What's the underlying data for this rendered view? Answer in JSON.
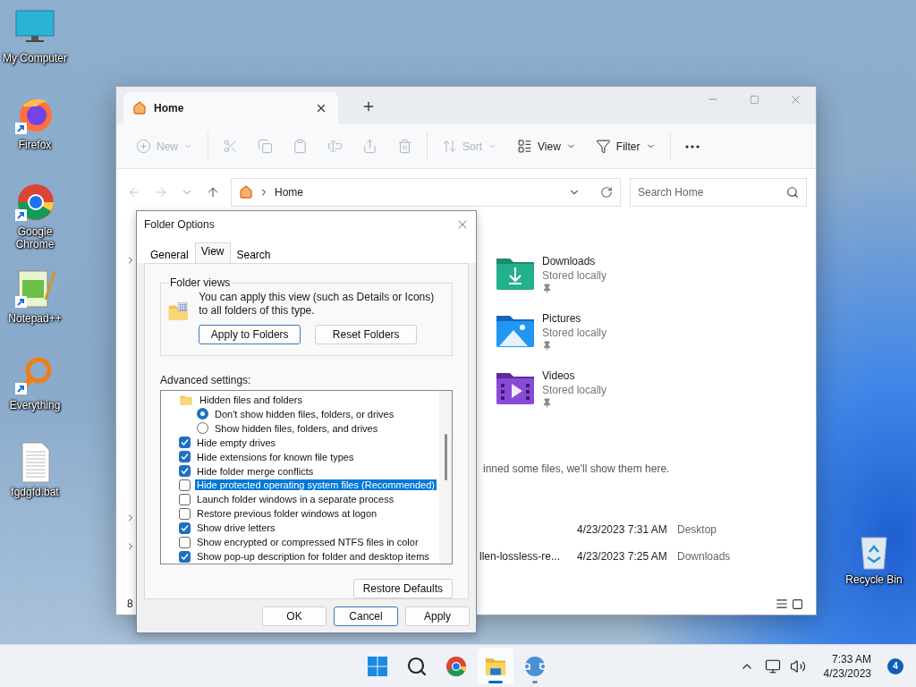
{
  "desktop_icons": [
    {
      "kind": "computer",
      "label": "My Computer",
      "shortcut": false
    },
    {
      "kind": "firefox",
      "label": "Firefox",
      "shortcut": true
    },
    {
      "kind": "chrome",
      "label": "Google Chrome",
      "shortcut": true
    },
    {
      "kind": "notepad",
      "label": "Notepad++",
      "shortcut": true
    },
    {
      "kind": "everything",
      "label": "Everything",
      "shortcut": true
    },
    {
      "kind": "textfile",
      "label": "fgdgfd.bat",
      "shortcut": false
    }
  ],
  "recycle_bin": {
    "label": "Recycle Bin"
  },
  "explorer": {
    "tab": {
      "title": "Home"
    },
    "toolbar": [
      {
        "kind": "new",
        "label": "New",
        "disabled": true,
        "dropdown": true
      },
      {
        "kind": "cut",
        "disabled": true
      },
      {
        "kind": "copy",
        "disabled": true
      },
      {
        "kind": "paste",
        "disabled": true
      },
      {
        "kind": "rename",
        "disabled": true
      },
      {
        "kind": "share",
        "disabled": true
      },
      {
        "kind": "delete",
        "disabled": true
      },
      {
        "kind": "sort",
        "label": "Sort",
        "disabled": true,
        "dropdown": true
      },
      {
        "kind": "view",
        "label": "View",
        "disabled": false,
        "dropdown": true
      },
      {
        "kind": "filter",
        "label": "Filter",
        "disabled": false,
        "dropdown": true
      },
      {
        "kind": "more",
        "disabled": false
      }
    ],
    "address": {
      "crumb": "Home"
    },
    "search": {
      "placeholder": "Search Home"
    },
    "folders": [
      {
        "kind": "downloads",
        "name": "Downloads",
        "status": "Stored locally",
        "pinned": true
      },
      {
        "kind": "pictures",
        "name": "Pictures",
        "status": "Stored locally",
        "pinned": true
      },
      {
        "kind": "videos",
        "name": "Videos",
        "status": "Stored locally",
        "pinned": true
      }
    ],
    "favorites_message": "inned some files, we'll show them here.",
    "recent": [
      {
        "date": "4/23/2023 7:31 AM",
        "location": "Desktop"
      },
      {
        "name": "llen-lossless-re...",
        "date": "4/23/2023 7:25 AM",
        "location": "Downloads"
      }
    ],
    "status_bar": {
      "item_count": "8"
    }
  },
  "dialog": {
    "title": "Folder Options",
    "tabs": [
      {
        "label": "General",
        "selected": false
      },
      {
        "label": "View",
        "selected": true
      },
      {
        "label": "Search",
        "selected": false
      }
    ],
    "folder_views": {
      "legend": "Folder views",
      "text": "You can apply this view (such as Details or Icons) to all folders of this type.",
      "buttons": [
        "Apply to Folders",
        "Reset Folders"
      ]
    },
    "advanced_label": "Advanced settings:",
    "items": [
      {
        "kind": "folder",
        "label": "Hidden files and folders",
        "selected": false,
        "children": [
          {
            "kind": "radio",
            "label": "Don't show hidden files, folders, or drives",
            "checked": true,
            "selected": false
          },
          {
            "kind": "radio",
            "label": "Show hidden files, folders, and drives",
            "checked": false,
            "selected": false
          }
        ]
      },
      {
        "kind": "checkbox",
        "label": "Hide empty drives",
        "checked": true,
        "selected": false
      },
      {
        "kind": "checkbox",
        "label": "Hide extensions for known file types",
        "checked": true,
        "selected": false
      },
      {
        "kind": "checkbox",
        "label": "Hide folder merge conflicts",
        "checked": true,
        "selected": false
      },
      {
        "kind": "checkbox",
        "label": "Hide protected operating system files (Recommended)",
        "checked": false,
        "selected": true
      },
      {
        "kind": "checkbox",
        "label": "Launch folder windows in a separate process",
        "checked": false,
        "selected": false
      },
      {
        "kind": "checkbox",
        "label": "Restore previous folder windows at logon",
        "checked": false,
        "selected": false
      },
      {
        "kind": "checkbox",
        "label": "Show drive letters",
        "checked": true,
        "selected": false
      },
      {
        "kind": "checkbox",
        "label": "Show encrypted or compressed NTFS files in color",
        "checked": false,
        "selected": false
      },
      {
        "kind": "checkbox",
        "label": "Show pop-up description for folder and desktop items",
        "checked": true,
        "selected": false
      }
    ],
    "restore_button": "Restore Defaults",
    "buttons": [
      "OK",
      "Cancel",
      "Apply"
    ]
  },
  "taskbar": {
    "apps": [
      {
        "kind": "start",
        "active": false,
        "running": false
      },
      {
        "kind": "search",
        "active": false,
        "running": false
      },
      {
        "kind": "chrome",
        "active": false,
        "running": false
      },
      {
        "kind": "explorer",
        "active": true,
        "running": true
      },
      {
        "kind": "qbittorrent",
        "active": false,
        "running": true
      }
    ],
    "time": "7:33 AM",
    "date": "4/23/2023",
    "notifications": "4"
  }
}
